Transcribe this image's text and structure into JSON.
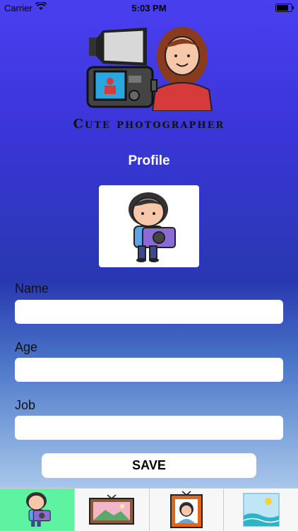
{
  "status_bar": {
    "carrier": "Carrier",
    "time": "5:03 PM",
    "battery_level": 0.9
  },
  "brand": {
    "title": "Cute photographer"
  },
  "page": {
    "title": "Profile"
  },
  "form": {
    "fields": [
      {
        "label": "Name",
        "value": "",
        "placeholder": ""
      },
      {
        "label": "Age",
        "value": "",
        "placeholder": ""
      },
      {
        "label": "Job",
        "value": "",
        "placeholder": ""
      }
    ],
    "save_label": "SAVE"
  },
  "tabs": [
    {
      "icon": "photographer-icon",
      "active": true
    },
    {
      "icon": "landscape-picture-icon",
      "active": false
    },
    {
      "icon": "portrait-frame-icon",
      "active": false
    },
    {
      "icon": "seascape-picture-icon",
      "active": false
    }
  ],
  "colors": {
    "active_tab": "#5df3a0",
    "gradient_top": "#4a3ff0",
    "gradient_bottom": "#a9c6ea"
  }
}
